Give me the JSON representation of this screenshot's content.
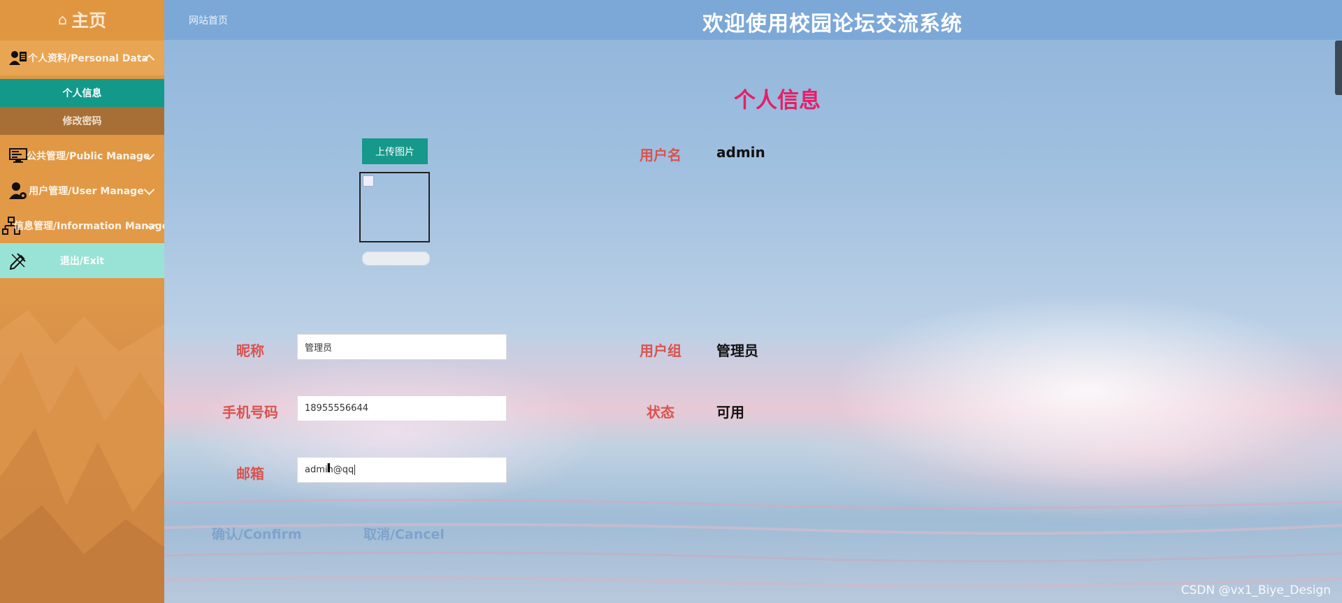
{
  "sidebar": {
    "home": {
      "icon": "home-icon",
      "label": "主页"
    },
    "groups": [
      {
        "label": "个人资料/Personal Data",
        "icon": "personal-data-icon",
        "expanded": true,
        "items": [
          {
            "label": "个人信息",
            "active": true
          },
          {
            "label": "修改密码",
            "active": false
          }
        ]
      },
      {
        "label": "公共管理/Public Manage",
        "icon": "monitor-icon",
        "expanded": false
      },
      {
        "label": "用户管理/User Manage",
        "icon": "user-settings-icon",
        "expanded": false
      },
      {
        "label": "信息管理/Information Manage",
        "icon": "sitemap-icon",
        "expanded": false
      }
    ],
    "exit": {
      "label": "退出/Exit",
      "icon": "exit-icon"
    }
  },
  "header": {
    "breadcrumb": "网站首页",
    "title": "欢迎使用校园论坛交流系统"
  },
  "page": {
    "title": "个人信息",
    "upload_label": "上传图片",
    "fields": {
      "nickname": {
        "label": "昵称",
        "value": "管理员"
      },
      "phone": {
        "label": "手机号码",
        "value": "18955556644"
      },
      "email": {
        "label": "邮箱",
        "value": "admin@qq"
      }
    },
    "info": {
      "username": {
        "label": "用户名",
        "value": "admin"
      },
      "usergroup": {
        "label": "用户组",
        "value": "管理员"
      },
      "status": {
        "label": "状态",
        "value": "可用"
      }
    },
    "confirm_label": "确认/Confirm",
    "cancel_label": "取消/Cancel"
  },
  "watermark": "CSDN @vx1_Biye_Design",
  "colors": {
    "sidebar": "#e0963f",
    "active_item": "#12998a",
    "exit_bg": "#99e3d6",
    "label_red": "#d9534f",
    "title_pink": "#e61f67",
    "button_teal": "#16988a"
  }
}
